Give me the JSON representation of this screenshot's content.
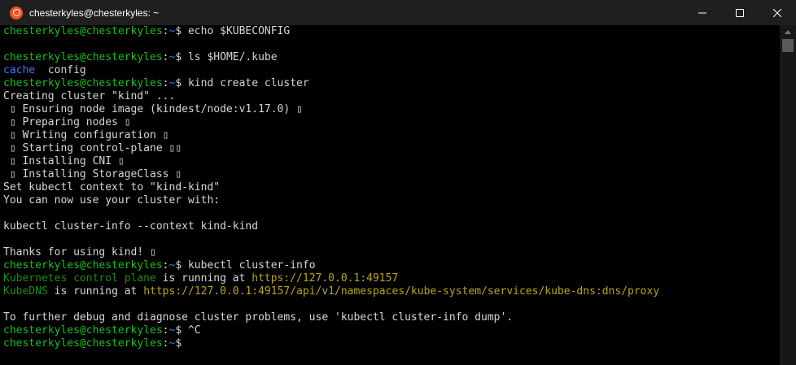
{
  "window": {
    "title": "chesterkyles@chesterkyles: ~",
    "icon": "ubuntu-icon",
    "controls": {
      "minimize": "minimize-icon",
      "maximize": "maximize-icon",
      "close": "close-icon"
    }
  },
  "colors": {
    "prompt_user": "#13c116",
    "prompt_path": "#3b78ff",
    "text": "#d6d6d6",
    "url": "#b9a41b",
    "dim_green": "#1b8c1b",
    "background": "#000000"
  },
  "prompt": {
    "userhost": "chesterkyles@chesterkyles",
    "sep": ":",
    "path": "~",
    "symbol": "$ "
  },
  "terminal": {
    "cmd1": "echo $KUBECONFIG",
    "cmd2": "ls $HOME/.kube",
    "ls_dir": "cache",
    "ls_file": "  config",
    "cmd3": "kind create cluster",
    "out_creating": "Creating cluster \"kind\" ...",
    "out_ensuring": " ▯ Ensuring node image (kindest/node:v1.17.0) ▯",
    "out_preparing": " ▯ Preparing nodes ▯",
    "out_writing": " ▯ Writing configuration ▯",
    "out_starting": " ▯ Starting control-plane ▯▯",
    "out_cni": " ▯ Installing CNI ▯",
    "out_storage": " ▯ Installing StorageClass ▯",
    "out_setctx": "Set kubectl context to \"kind-kind\"",
    "out_youcan": "You can now use your cluster with:",
    "out_kubectl": "kubectl cluster-info --context kind-kind",
    "out_thanks": "Thanks for using kind! ▯",
    "cmd4": "kubectl cluster-info",
    "k8s_label": "Kubernetes control plane",
    "k8s_mid": " is running at ",
    "k8s_url": "https://127.0.0.1:49157",
    "dns_label": "KubeDNS",
    "dns_mid": " is running at ",
    "dns_url": "https://127.0.0.1:49157/api/v1/namespaces/kube-system/services/kube-dns:dns/proxy",
    "out_debug": "To further debug and diagnose cluster problems, use 'kubectl cluster-info dump'.",
    "cmd5": "^C",
    "cmd6": ""
  }
}
